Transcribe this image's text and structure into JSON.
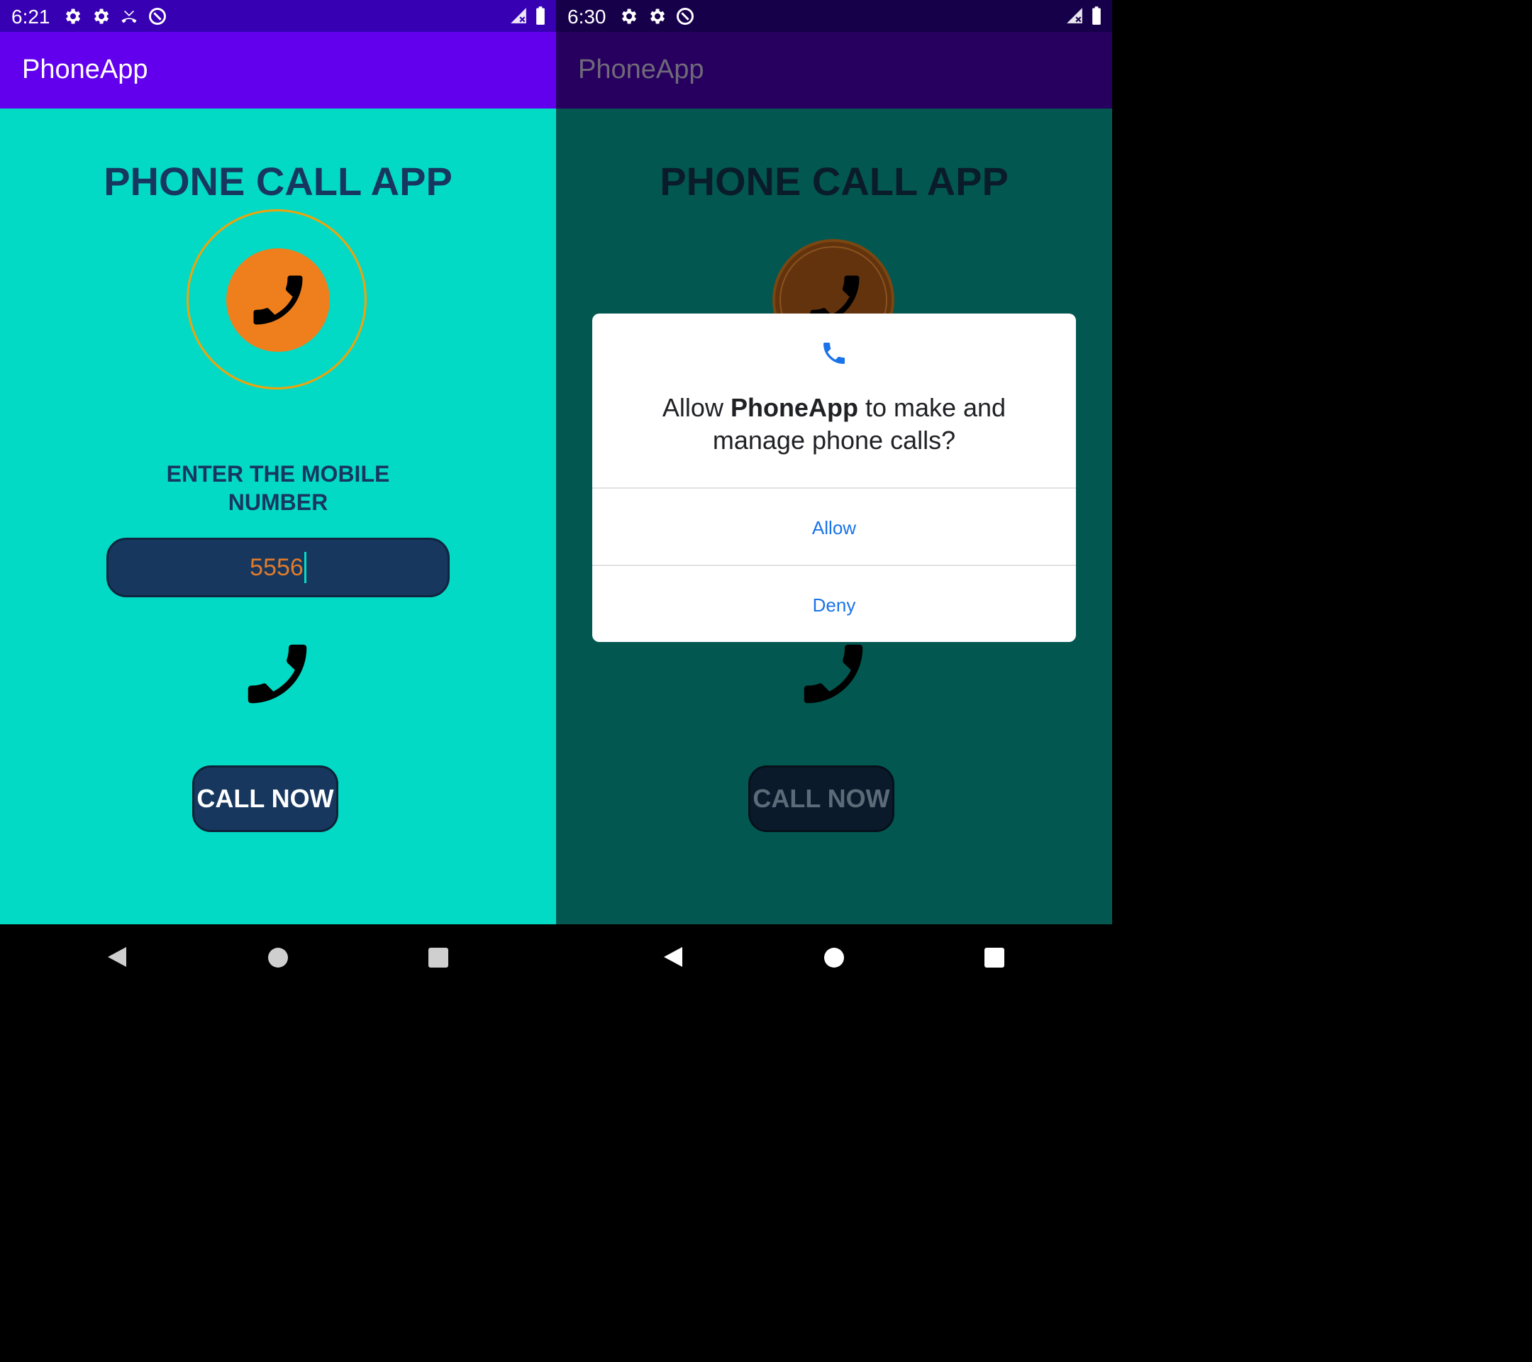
{
  "left_screen": {
    "status_bar": {
      "time": "6:21"
    },
    "app_bar": {
      "title": "PhoneApp"
    },
    "heading": "PHONE CALL APP",
    "label_line1": "ENTER THE MOBILE",
    "label_line2": "NUMBER",
    "input": {
      "value": "5556"
    },
    "call_button": "CALL NOW"
  },
  "right_screen": {
    "status_bar": {
      "time": "6:30"
    },
    "app_bar": {
      "title": "PhoneApp"
    },
    "heading": "PHONE CALL APP",
    "call_button": "CALL NOW",
    "dialog": {
      "message_prefix": "Allow ",
      "app_name": "PhoneApp",
      "message_suffix": " to make and manage phone calls?",
      "allow": "Allow",
      "deny": "Deny"
    }
  },
  "colors": {
    "status_bar": "#3700B3",
    "app_bar": "#6200EE",
    "content_bg": "#03DAC5",
    "heading": "#17375e",
    "accent_orange": "#ef7f1c",
    "dialog_button": "#1a73e8"
  },
  "icons": [
    "settings-icon",
    "missed-call-icon",
    "sync-icon",
    "signal-icon",
    "battery-icon",
    "phone-icon",
    "back-icon",
    "home-icon",
    "recents-icon"
  ]
}
